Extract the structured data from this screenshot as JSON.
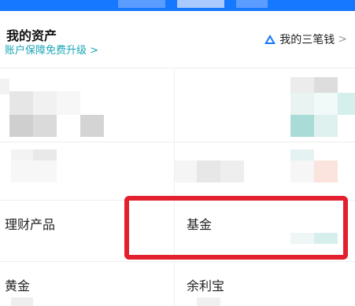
{
  "header": {
    "title": "我的资产",
    "subtitle": "账户保障免费升级",
    "subtitle_chevron": ">",
    "right_link_label": "我的三笔钱",
    "right_link_chevron": ">"
  },
  "menu": {
    "row1_left": "理财产品",
    "row1_right": "基金",
    "row2_left": "黄金",
    "row2_right": "余利宝"
  },
  "colors": {
    "brand_blue": "#1677ff",
    "subtitle_teal": "#1aa6b7",
    "highlight_red": "#e3202d"
  },
  "icons": {
    "right_link_icon": "triangle-logo-icon"
  }
}
